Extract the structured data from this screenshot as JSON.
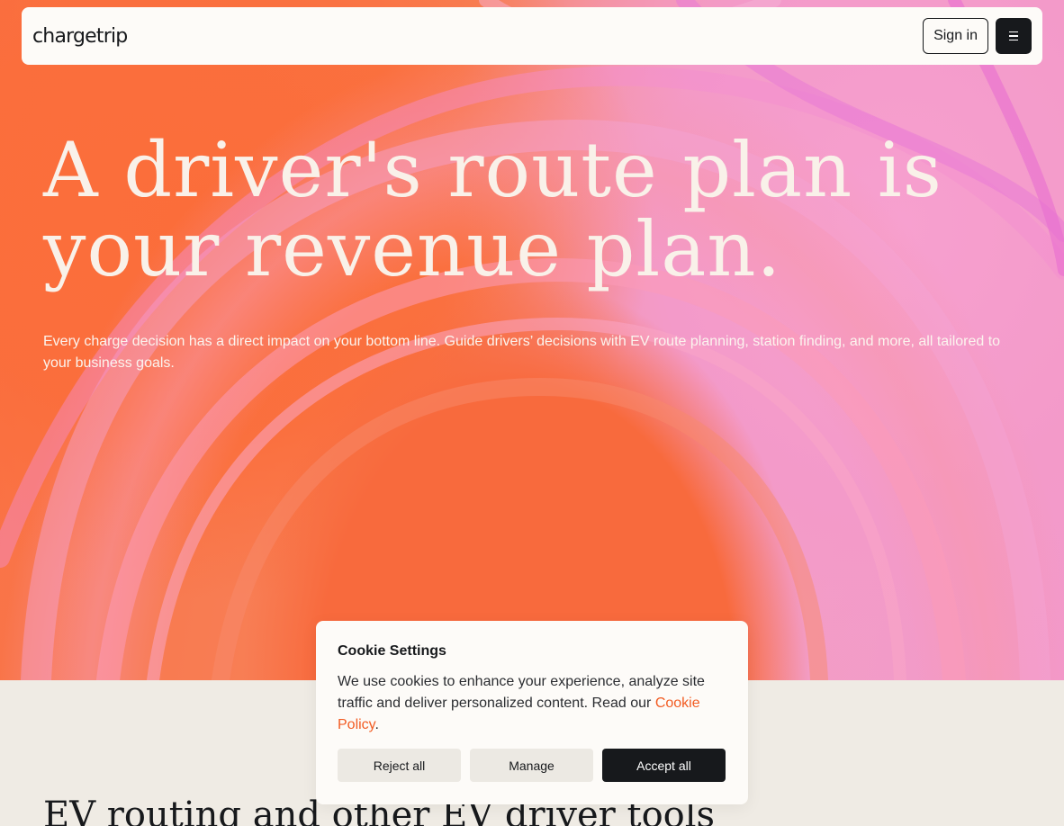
{
  "header": {
    "logo_text": "chargetrip",
    "signin_label": "Sign in",
    "menu_icon": "hamburger-menu-icon"
  },
  "hero": {
    "headline_line1": "A driver's route plan is",
    "headline_line2": "your revenue plan.",
    "subtext": "Every charge decision has a direct impact on your bottom line. Guide drivers’ decisions with EV route planning, station finding, and more, all tailored to your business goals."
  },
  "section": {
    "title": "EV routing and other EV driver tools"
  },
  "cookie": {
    "title": "Cookie Settings",
    "body": "We use cookies to enhance your experience, analyze site traffic and deliver personalized content. Read our ",
    "link_text": "Cookie Policy",
    "body_end": ".",
    "reject_label": "Reject all",
    "manage_label": "Manage",
    "accept_label": "Accept all"
  },
  "colors": {
    "hero_orange": "#f86a3d",
    "hero_pink": "#f298cd",
    "dark": "#17191c",
    "link": "#f25c23",
    "page_bg": "#efebe4"
  }
}
